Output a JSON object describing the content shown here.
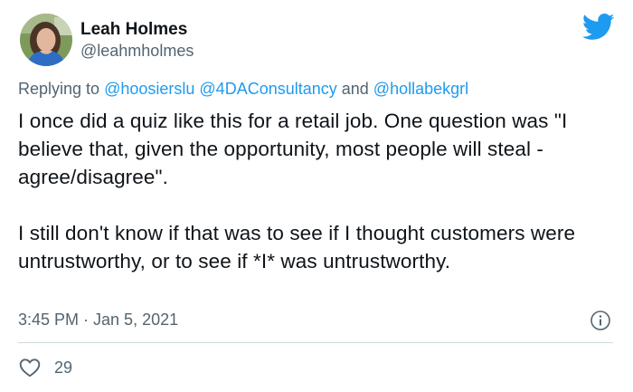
{
  "author": {
    "name": "Leah Holmes",
    "handle": "@leahmholmes"
  },
  "reply": {
    "prefix": "Replying to ",
    "mention1": "@hoosierslu",
    "mention2": "@4DAConsultancy",
    "joiner": " and ",
    "mention3": "@hollabekgrl"
  },
  "tweet": {
    "text": "I once did a quiz like this for a retail job. One question was \"I believe that, given the opportunity, most people will steal - agree/disagree\".\n\nI still don't know if that was to see if I thought customers were untrustworthy, or to see if *I* was untrustworthy.",
    "timestamp": "3:45 PM · Jan 5, 2021",
    "likes": "29"
  },
  "icons": {
    "brand": "twitter-bird-icon",
    "info": "info-icon",
    "like": "heart-icon"
  },
  "colors": {
    "accent": "#1d9bf0",
    "secondary_text": "#536471",
    "divider": "#cfd9de"
  }
}
